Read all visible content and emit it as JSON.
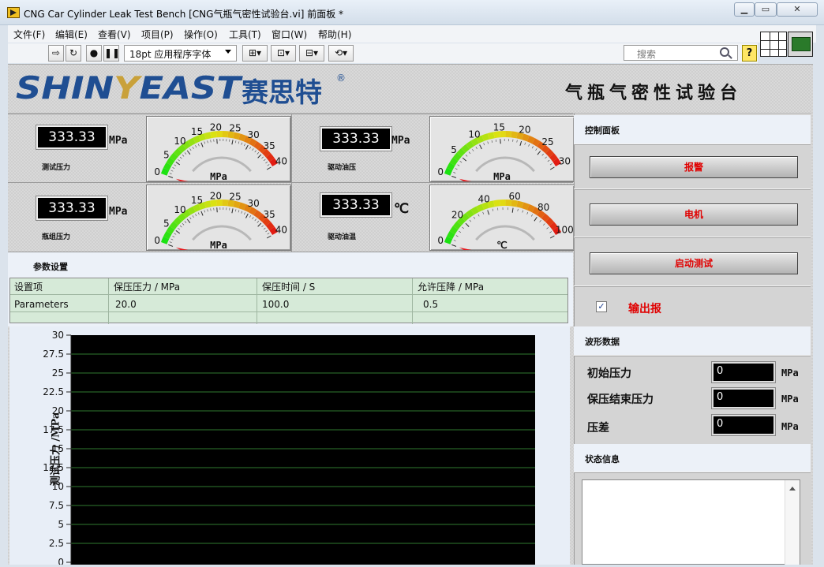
{
  "window": {
    "title": "CNG Car Cylinder Leak Test Bench [CNG气瓶气密性试验台.vi] 前面板 *",
    "min": "▁",
    "max": "▭",
    "close": "✕"
  },
  "menu": [
    "文件(F)",
    "编辑(E)",
    "查看(V)",
    "项目(P)",
    "操作(O)",
    "工具(T)",
    "窗口(W)",
    "帮助(H)"
  ],
  "toolbar": {
    "font": "18pt 应用程序字体",
    "search_placeholder": "搜索",
    "help": "?"
  },
  "banner": {
    "logo_a": "SHIN",
    "logo_y": "Y",
    "logo_b": "EAST",
    "logo_cn": "赛思特",
    "reg": "®",
    "title": "气瓶气密性试验台"
  },
  "indicators": {
    "test_pressure": {
      "value": "333.33",
      "unit": "MPa",
      "label": "测试压力"
    },
    "drive_oil_pressure": {
      "value": "333.33",
      "unit": "MPa",
      "label": "驱动油压"
    },
    "cylinder_pressure": {
      "value": "333.33",
      "unit": "MPa",
      "label": "瓶组压力"
    },
    "drive_oil_temp": {
      "value": "333.33",
      "unit": "℃",
      "label": "驱动油温"
    }
  },
  "gauges": [
    {
      "id": "g1",
      "ticks": [
        0,
        5,
        10,
        15,
        20,
        25,
        30,
        35,
        40
      ],
      "min": 0,
      "max": 40,
      "value": 0,
      "unit": "MPa"
    },
    {
      "id": "g2",
      "ticks": [
        0,
        5,
        10,
        15,
        20,
        25,
        30
      ],
      "min": 0,
      "max": 30,
      "value": 0,
      "unit": "MPa"
    },
    {
      "id": "g3",
      "ticks": [
        0,
        5,
        10,
        15,
        20,
        25,
        30,
        35,
        40
      ],
      "min": 0,
      "max": 40,
      "value": 0,
      "unit": "MPa"
    },
    {
      "id": "g4",
      "ticks": [
        0,
        20,
        40,
        60,
        80,
        100
      ],
      "min": 0,
      "max": 100,
      "value": 0,
      "unit": "℃"
    }
  ],
  "params": {
    "title": "参数设置",
    "headers": [
      "设置项",
      "保压压力 / MPa",
      "保压时间 / S",
      "允许压降 / MPa"
    ],
    "row": [
      "Parameters",
      "20.0",
      "100.0",
      "0.5"
    ]
  },
  "chart_data": {
    "type": "line",
    "ylabel": "测试压力 /MPa",
    "ylim": [
      0,
      30
    ],
    "yticks": [
      "0",
      "2.5",
      "5",
      "7.5",
      "10",
      "12.5",
      "15",
      "17.5",
      "20",
      "22.5",
      "25",
      "27.5",
      "30"
    ],
    "series": [],
    "grid": true,
    "plot_bg": "#000000",
    "grid_color": "#2f7a2f"
  },
  "control": {
    "title": "控制面板",
    "alarm_btn": "报警",
    "motor_btn": "电机",
    "start_btn": "启动测试",
    "output_chk": "✓",
    "output_lbl": "输出报"
  },
  "wave": {
    "title": "波形数据",
    "rows": [
      {
        "label": "初始压力",
        "value": "0",
        "unit": "MPa"
      },
      {
        "label": "保压结束压力",
        "value": "0",
        "unit": "MPa"
      },
      {
        "label": "压差",
        "value": "0",
        "unit": "MPa"
      }
    ]
  },
  "status": {
    "title": "状态信息"
  }
}
